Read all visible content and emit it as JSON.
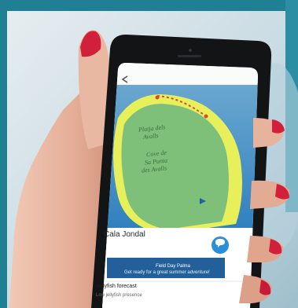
{
  "photo": {
    "colors": {
      "backdrop_teal": "#1f7f93",
      "backdrop_light": "#d8e6ec",
      "phone_frame": "#121416",
      "ocean": "#3a86c2",
      "island_green": "#7ec07a",
      "coast_yellow": "#e7f05a",
      "route_red": "#d9473a",
      "skin": "#e9b8a2",
      "nail_red": "#d11f3c",
      "banner_blue": "#1f4f83",
      "fab_blue": "#2a8fd6"
    },
    "icons": [
      "back-arrow-icon",
      "user-location-icon",
      "speech-bubble-icon",
      "app-logo-icon"
    ],
    "map_labels": {
      "line1": "Platja dels",
      "line2": "Avalls",
      "line3": "Cove de",
      "line4": "Sa Punta",
      "line5": "des Avalls"
    },
    "place_card": {
      "title": "Cala Jondal",
      "banner_line1": "Field Day Palma",
      "banner_line2": "Get ready for a great summer adventure!",
      "sub_title": "Jellyfish forecast",
      "sub_line": "Low jellyfish presence"
    }
  }
}
